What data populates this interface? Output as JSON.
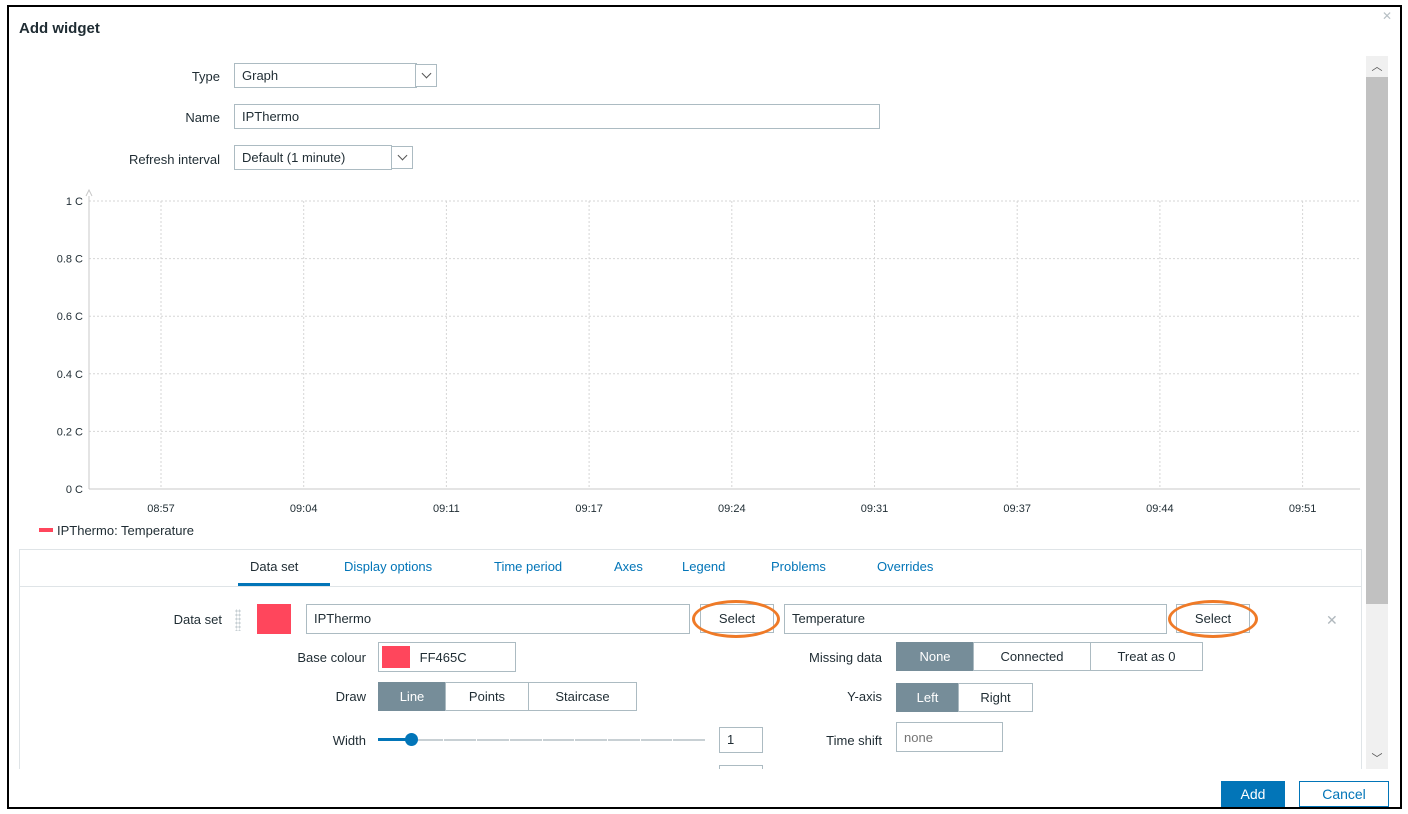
{
  "dialog": {
    "title": "Add widget",
    "close_icon": "close-icon",
    "add_label": "Add",
    "cancel_label": "Cancel"
  },
  "form": {
    "type_label": "Type",
    "type_value": "Graph",
    "name_label": "Name",
    "name_value": "IPThermo",
    "refresh_label": "Refresh interval",
    "refresh_value": "Default (1 minute)"
  },
  "chart_data": {
    "type": "line",
    "y_tick_labels": [
      "1 C",
      "0.8 C",
      "0.6 C",
      "0.4 C",
      "0.2 C",
      "0 C"
    ],
    "ylim": [
      0,
      1
    ],
    "x_tick_labels": [
      "08:57",
      "09:04",
      "09:11",
      "09:17",
      "09:24",
      "09:31",
      "09:37",
      "09:44",
      "09:51"
    ],
    "series": [
      {
        "name": "IPThermo: Temperature",
        "color": "#ff465c",
        "values": []
      }
    ],
    "grid": true,
    "legend_position": "bottom-left"
  },
  "tabs": [
    {
      "label": "Data set",
      "active": true
    },
    {
      "label": "Display options",
      "active": false
    },
    {
      "label": "Time period",
      "active": false
    },
    {
      "label": "Axes",
      "active": false
    },
    {
      "label": "Legend",
      "active": false
    },
    {
      "label": "Problems",
      "active": false
    },
    {
      "label": "Overrides",
      "active": false
    }
  ],
  "dataset": {
    "label": "Data set",
    "color": "#ff465c",
    "host_value": "IPThermo",
    "select_label": "Select",
    "item_value": "Temperature",
    "base_colour_label": "Base colour",
    "base_colour_value": "FF465C",
    "draw_label": "Draw",
    "draw_options": [
      "Line",
      "Points",
      "Staircase"
    ],
    "draw_selected": "Line",
    "width_label": "Width",
    "width_value": "1",
    "width_fraction": 0.1,
    "missing_label": "Missing data",
    "missing_options": [
      "None",
      "Connected",
      "Treat as 0"
    ],
    "missing_selected": "None",
    "yaxis_label": "Y-axis",
    "yaxis_options": [
      "Left",
      "Right"
    ],
    "yaxis_selected": "Left",
    "timeshift_label": "Time shift",
    "timeshift_placeholder": "none"
  }
}
